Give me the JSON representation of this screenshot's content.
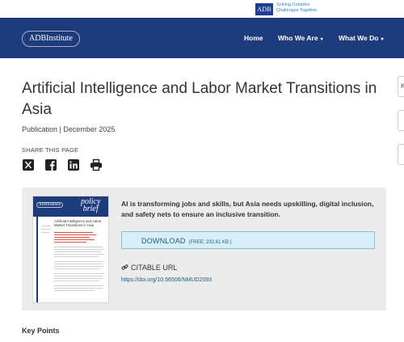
{
  "top": {
    "adb_logo": "ADB",
    "tagline_1": "Solving Complex",
    "tagline_2": "Challenges Together"
  },
  "nav": {
    "logo": "ADBInstitute",
    "items": [
      {
        "label": "Home",
        "has_caret": false
      },
      {
        "label": "Who We Are",
        "has_caret": true
      },
      {
        "label": "What We Do",
        "has_caret": true
      }
    ],
    "caret": "▾"
  },
  "right_slivers": [
    "K",
    "",
    ""
  ],
  "article": {
    "title": "Artificial Intelligence and Labor Market Transitions in Asia",
    "meta": "Publication | December 2025",
    "share_label": "SHARE THIS PAGE",
    "share_icons": [
      "x-icon",
      "facebook-icon",
      "linkedin-icon",
      "print-icon"
    ]
  },
  "cover": {
    "adbi": "ADBInstitute",
    "policy_1": "policy",
    "policy_2": "brief",
    "title": "Artificial Intelligence and Labor Market Transitions in Asia"
  },
  "summary": {
    "text": "AI is transforming jobs and skills, but Asia needs upskilling, digital inclusion, and safety nets to ensure an inclusive transition.",
    "download_label": "DOWNLOAD",
    "download_size": "(FREE: 233.61 KB )",
    "cite_label": "CITABLE URL",
    "cite_url": "https://doi.org/10.56506/NMUD2093"
  },
  "key_points": "Key Points",
  "colors": {
    "nav": "#1e3c7b",
    "accent_link": "#1a5f87",
    "download_bg": "#d8eef6",
    "box_bg": "#ebebeb"
  }
}
